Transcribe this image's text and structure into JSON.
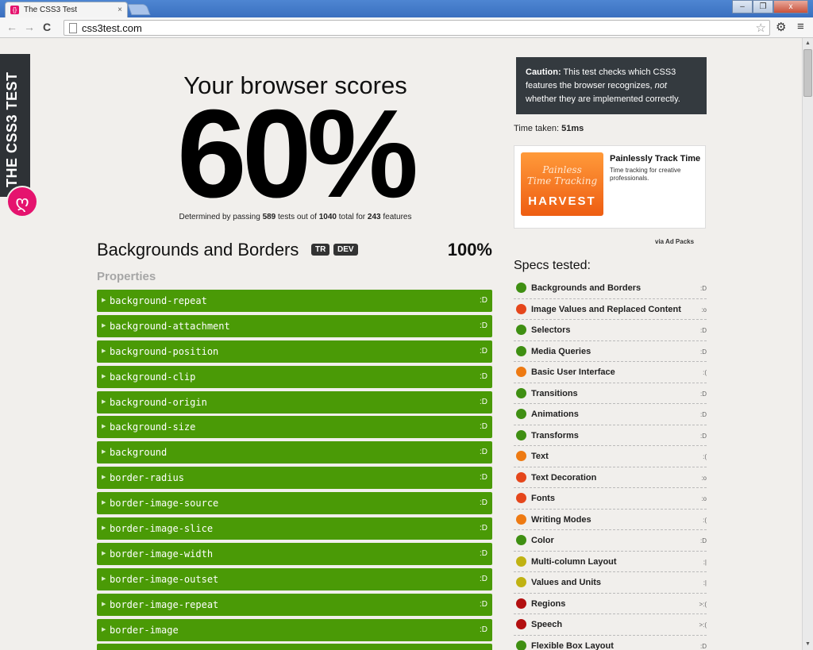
{
  "browser": {
    "tab_title": "The CSS3 Test",
    "tab_close": "×",
    "win_minimize": "–",
    "win_restore": "❐",
    "win_close": "x",
    "back": "←",
    "forward": "→",
    "reload": "C",
    "url": "css3test.com",
    "star": "☆",
    "settings": "⚙",
    "menu": "≡"
  },
  "ribbon": {
    "text": "THE CSS3 TEST",
    "logo": "ღ"
  },
  "hero": {
    "title": "Your browser scores",
    "score": "60%",
    "sub_prefix": "Determined by passing ",
    "tests_passed": "589",
    "sub_mid1": " tests out of ",
    "tests_total": "1040",
    "sub_mid2": " total for ",
    "features": "243",
    "sub_suffix": " features"
  },
  "section": {
    "title": "Backgrounds and Borders",
    "badge_tr": "TR",
    "badge_dev": "DEV",
    "score": "100%",
    "props_label": "Properties"
  },
  "features": [
    {
      "name": "background-repeat",
      "result": ":D"
    },
    {
      "name": "background-attachment",
      "result": ":D"
    },
    {
      "name": "background-position",
      "result": ":D"
    },
    {
      "name": "background-clip",
      "result": ":D"
    },
    {
      "name": "background-origin",
      "result": ":D"
    },
    {
      "name": "background-size",
      "result": ":D"
    },
    {
      "name": "background",
      "result": ":D"
    },
    {
      "name": "border-radius",
      "result": ":D"
    },
    {
      "name": "border-image-source",
      "result": ":D"
    },
    {
      "name": "border-image-slice",
      "result": ":D"
    },
    {
      "name": "border-image-width",
      "result": ":D"
    },
    {
      "name": "border-image-outset",
      "result": ":D"
    },
    {
      "name": "border-image-repeat",
      "result": ":D"
    },
    {
      "name": "border-image",
      "result": ":D"
    },
    {
      "name": "",
      "result": ""
    }
  ],
  "caution": {
    "label": "Caution:",
    "text_before": " This test checks which CSS3 features the browser recognizes, ",
    "em": "not",
    "text_after": " whether they are implemented correctly."
  },
  "time": {
    "label": "Time taken: ",
    "value": "51ms"
  },
  "ad": {
    "img_line1": "Painless",
    "img_line2": "Time Tracking",
    "img_brand": "HARVEST",
    "title": "Painlessly Track Time",
    "desc": "Time tracking for creative professionals.",
    "via": "via Ad Packs"
  },
  "specs": {
    "title": "Specs tested:",
    "items": [
      {
        "name": "Backgrounds and Borders",
        "result": ":D",
        "color": "#3f8f12"
      },
      {
        "name": "Image Values and Replaced Content",
        "result": ":o",
        "color": "#e5461b"
      },
      {
        "name": "Selectors",
        "result": ":D",
        "color": "#3f8f12"
      },
      {
        "name": "Media Queries",
        "result": ":D",
        "color": "#3f8f12"
      },
      {
        "name": "Basic User Interface",
        "result": ":(",
        "color": "#ee7a12"
      },
      {
        "name": "Transitions",
        "result": ":D",
        "color": "#3f8f12"
      },
      {
        "name": "Animations",
        "result": ":D",
        "color": "#3f8f12"
      },
      {
        "name": "Transforms",
        "result": ":D",
        "color": "#3f8f12"
      },
      {
        "name": "Text",
        "result": ":(",
        "color": "#ee7a12"
      },
      {
        "name": "Text Decoration",
        "result": ":o",
        "color": "#e5461b"
      },
      {
        "name": "Fonts",
        "result": ":o",
        "color": "#e5461b"
      },
      {
        "name": "Writing Modes",
        "result": ":(",
        "color": "#ee7a12"
      },
      {
        "name": "Color",
        "result": ":D",
        "color": "#3f8f12"
      },
      {
        "name": "Multi-column Layout",
        "result": ":|",
        "color": "#c0b212"
      },
      {
        "name": "Values and Units",
        "result": ":|",
        "color": "#c0b212"
      },
      {
        "name": "Regions",
        "result": ">:(",
        "color": "#b31010"
      },
      {
        "name": "Speech",
        "result": ">:(",
        "color": "#b31010"
      },
      {
        "name": "Flexible Box Layout",
        "result": ":D",
        "color": "#3f8f12"
      }
    ]
  }
}
